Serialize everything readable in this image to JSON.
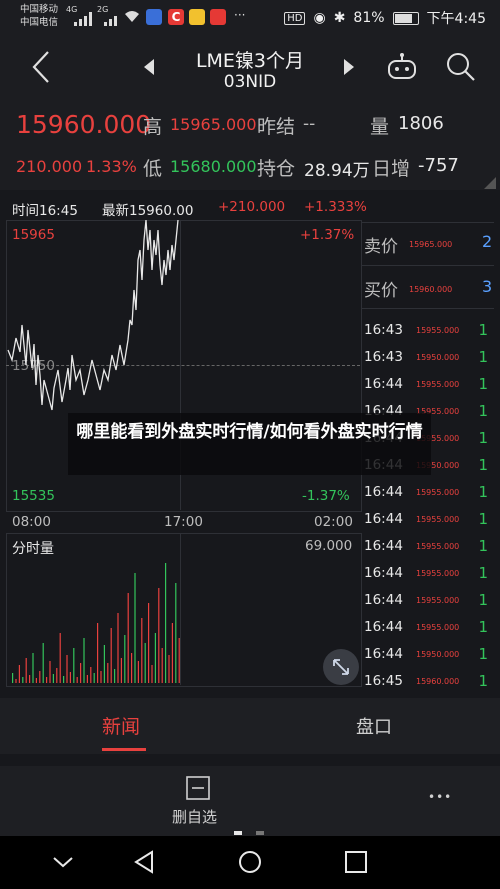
{
  "status": {
    "carrier1": "中国移动",
    "carrier2": "中国电信",
    "net1": "4G",
    "net2": "2G",
    "battery": "81%",
    "time": "下午4:45",
    "hd": "HD",
    "more": "···"
  },
  "header": {
    "title_line1": "LME镍3个月",
    "title_line2": "03NID"
  },
  "quote": {
    "last_price": "15960.000",
    "high_label": "高",
    "high_value": "15965.000",
    "prev_close_label": "昨结",
    "prev_close_value": "--",
    "volume_label": "量",
    "volume_value": "1806",
    "change": "210.000",
    "change_pct": "1.33%",
    "low_label": "低",
    "low_value": "15680.000",
    "oi_label": "持仓",
    "oi_value": "28.94万",
    "daily_inc_label": "日增",
    "daily_inc_value": "-757"
  },
  "chart": {
    "info_time_label": "时间16:45",
    "info_latest_label": "最新15960.00",
    "info_change": "+210.000",
    "info_change_pct": "+1.333%",
    "y_top": "15965",
    "y_top_pct": "+1.37%",
    "y_mid": "15750",
    "y_bottom": "15535",
    "y_bottom_pct": "-1.37%",
    "x_labels": [
      "08:00",
      "17:00",
      "02:00"
    ],
    "volume_label": "分时量",
    "volume_max": "69.000"
  },
  "orderbook": {
    "ask_label": "卖价",
    "ask_price": "15965.000",
    "ask_qty": "2",
    "bid_label": "买价",
    "bid_price": "15960.000",
    "bid_qty": "3"
  },
  "ticks": [
    {
      "time": "16:43",
      "price": "15955.000",
      "vol": "1"
    },
    {
      "time": "16:43",
      "price": "15950.000",
      "vol": "1"
    },
    {
      "time": "16:44",
      "price": "15955.000",
      "vol": "1"
    },
    {
      "time": "16:44",
      "price": "15955.000",
      "vol": "1"
    },
    {
      "time": "16:44",
      "price": "15955.000",
      "vol": "1"
    },
    {
      "time": "16:44",
      "price": "15950.000",
      "vol": "1"
    },
    {
      "time": "16:44",
      "price": "15955.000",
      "vol": "1"
    },
    {
      "time": "16:44",
      "price": "15955.000",
      "vol": "1"
    },
    {
      "time": "16:44",
      "price": "15955.000",
      "vol": "1"
    },
    {
      "time": "16:44",
      "price": "15955.000",
      "vol": "1"
    },
    {
      "time": "16:44",
      "price": "15955.000",
      "vol": "1"
    },
    {
      "time": "16:44",
      "price": "15955.000",
      "vol": "1"
    },
    {
      "time": "16:44",
      "price": "15950.000",
      "vol": "1"
    },
    {
      "time": "16:45",
      "price": "15960.000",
      "vol": "1"
    }
  ],
  "overlay_text": "哪里能看到外盘实时行情/如何看外盘实时行情",
  "tabs": {
    "news": "新闻",
    "handicap": "盘口"
  },
  "bottom": {
    "remove_label": "删自选",
    "more": "•••"
  },
  "colors": {
    "up": "#e8413e",
    "down": "#33c45b",
    "background": "#17181c"
  }
}
